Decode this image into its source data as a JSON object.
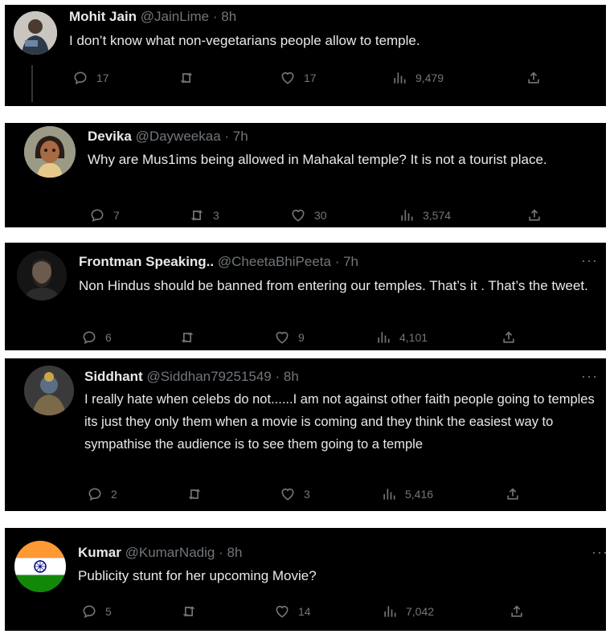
{
  "tweets": [
    {
      "name": "Mohit Jain",
      "handle": "@JainLime",
      "time": "8h",
      "text": "I don’t know what non-vegetarians people allow to temple.",
      "replies": "17",
      "retweets": "",
      "likes": "17",
      "views": "9,479",
      "avatar_icon": "person-photo-icon"
    },
    {
      "name": "Devika",
      "handle": "@Dayweekaa",
      "time": "7h",
      "text": "Why are Mus1ims being allowed in Mahakal temple? It is not a tourist place.",
      "replies": "7",
      "retweets": "3",
      "likes": "30",
      "views": "3,574",
      "avatar_icon": "cartoon-woman-icon"
    },
    {
      "name": "Frontman Speaking..",
      "handle": "@CheetaBhiPeeta",
      "time": "7h",
      "text": "Non Hindus should be banned from entering our temples. That’s it . That’s the tweet.",
      "replies": "6",
      "retweets": "",
      "likes": "9",
      "views": "4,101",
      "avatar_icon": "bearded-man-icon"
    },
    {
      "name": "Siddhant",
      "handle": "@Siddhan79251549",
      "time": "8h",
      "text": "I really hate when celebs do not......I am not against other faith people going to temples its just they only them when a movie is coming and they think the easiest way to sympathise the audience is to see them going to a temple",
      "replies": "2",
      "retweets": "",
      "likes": "3",
      "views": "5,416",
      "avatar_icon": "deity-image-icon"
    },
    {
      "name": "Kumar",
      "handle": "@KumarNadig",
      "time": "8h",
      "text": "Publicity stunt for her upcoming Movie?",
      "replies": "5",
      "retweets": "",
      "likes": "14",
      "views": "7,042",
      "avatar_icon": "indian-flag-icon"
    }
  ],
  "dot": "·",
  "more_label": "···",
  "colors": {
    "card_bg": "#000000",
    "text": "#e7e9ea",
    "muted": "#71767b",
    "saffron": "#ff9933",
    "green": "#138808",
    "chakra": "#000080"
  }
}
